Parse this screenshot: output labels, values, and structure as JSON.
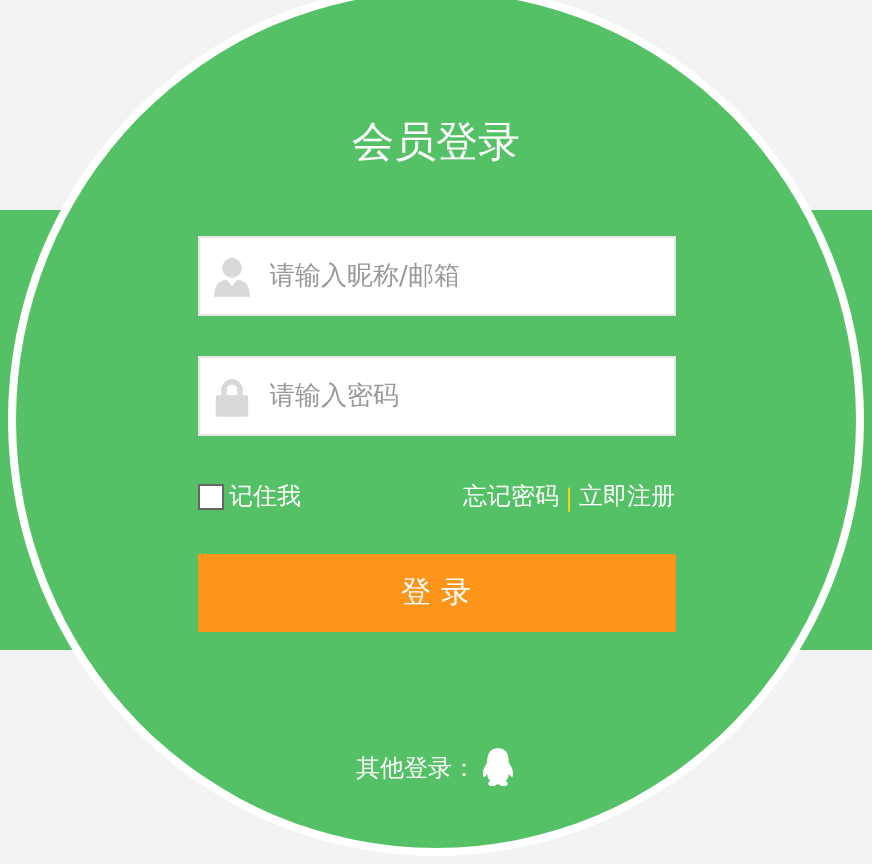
{
  "title": "会员登录",
  "fields": [
    {
      "kind": "user",
      "placeholder": "请输入昵称/邮箱"
    },
    {
      "kind": "lock",
      "placeholder": "请输入密码"
    }
  ],
  "remember": {
    "label": "记住我",
    "checked": false
  },
  "links": {
    "forgot": "忘记密码",
    "separator": "|",
    "register": "立即注册"
  },
  "login_button": "登 录",
  "other_login": {
    "label": "其他登录："
  }
}
